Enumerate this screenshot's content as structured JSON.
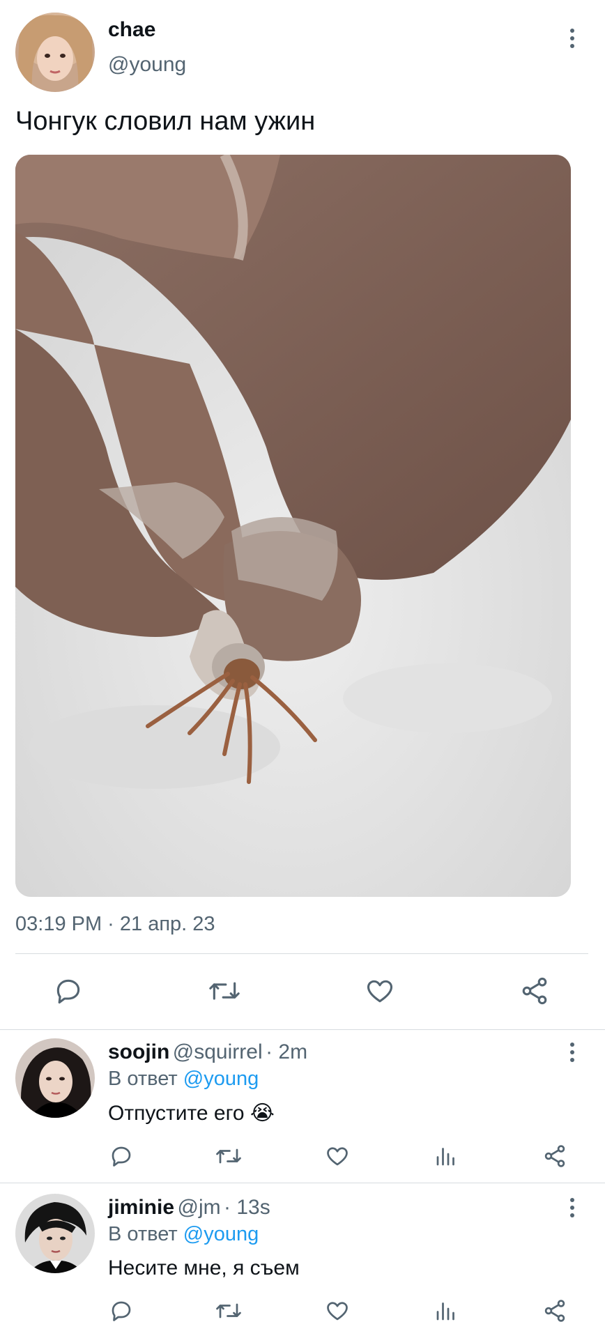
{
  "tweet": {
    "author_name": "chae",
    "author_handle": "@young",
    "text": "Чонгук словил нам ужин",
    "timestamp": "03:19 PM · 21 апр. 23",
    "image_alt": "hermit crab in a seashell held between fingers, sandy beach"
  },
  "actions": [
    "reply-icon",
    "retweet-icon",
    "like-icon",
    "share-icon"
  ],
  "replies": [
    {
      "name": "soojin",
      "handle": "@squirrel",
      "time": "· 2m",
      "reply_prefix": "В ответ",
      "reply_mention": "@young",
      "text": "Отпустите его 😭"
    },
    {
      "name": "jiminie",
      "handle": "@jm",
      "time": "· 13s",
      "reply_prefix": "В ответ",
      "reply_mention": "@young",
      "text": "Несите мне, я съем"
    }
  ],
  "colors": {
    "text": "#0f1419",
    "secondary": "#536471",
    "accent": "#1d9bf0",
    "divider": "#d7dbdf"
  }
}
